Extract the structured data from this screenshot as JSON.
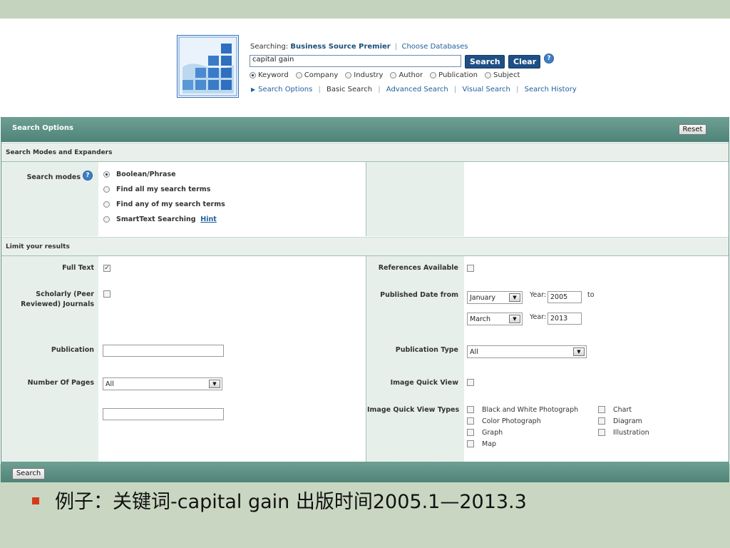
{
  "header": {
    "searching_label": "Searching:",
    "database": "Business Source Premier",
    "choose_databases": "Choose Databases",
    "query": "capital gain",
    "search_button": "Search",
    "clear_button": "Clear",
    "help": "?",
    "field_options": [
      {
        "label": "Keyword",
        "selected": true
      },
      {
        "label": "Company",
        "selected": false
      },
      {
        "label": "Industry",
        "selected": false
      },
      {
        "label": "Author",
        "selected": false
      },
      {
        "label": "Publication",
        "selected": false
      },
      {
        "label": "Subject",
        "selected": false
      }
    ],
    "links": {
      "search_options": "Search Options",
      "basic_search": "Basic Search",
      "advanced_search": "Advanced Search",
      "visual_search": "Visual Search",
      "search_history": "Search History"
    }
  },
  "options": {
    "title": "Search Options",
    "reset": "Reset",
    "modes_section": "Search Modes and Expanders",
    "modes_label": "Search modes",
    "modes": [
      {
        "label": "Boolean/Phrase",
        "selected": true
      },
      {
        "label": "Find all my search terms",
        "selected": false
      },
      {
        "label": "Find any of my search terms",
        "selected": false
      },
      {
        "label": "SmartText Searching",
        "selected": false
      }
    ],
    "hint": "Hint",
    "limit_section": "Limit your results",
    "full_text": {
      "label": "Full Text",
      "checked": true
    },
    "scholarly": {
      "label_line1": "Scholarly (Peer",
      "label_line2": "Reviewed) Journals",
      "checked": false
    },
    "publication": {
      "label": "Publication",
      "value": ""
    },
    "pages": {
      "label": "Number Of Pages",
      "value": "All"
    },
    "references": {
      "label": "References Available",
      "checked": false
    },
    "published_date": {
      "label": "Published Date from",
      "from_month": "January",
      "from_year_label": "Year:",
      "from_year": "2005",
      "to_label": "to",
      "to_month": "March",
      "to_year_label": "Year:",
      "to_year": "2013"
    },
    "publication_type": {
      "label": "Publication Type",
      "value": "All"
    },
    "image_quick_view": {
      "label": "Image Quick View",
      "checked": false
    },
    "image_types_label": "Image Quick View Types",
    "image_types": [
      "Black and White Photograph",
      "Color Photograph",
      "Graph",
      "Map",
      "Chart",
      "Diagram",
      "Illustration"
    ],
    "bottom_search": "Search"
  },
  "caption": "例子：关键词-capital gain  出版时间2005.1—2013.3",
  "colors": {
    "accent": "#4f8478",
    "button": "#1f4f86",
    "bullet": "#d43b1d",
    "slide_bg": "#c9d7c2"
  }
}
